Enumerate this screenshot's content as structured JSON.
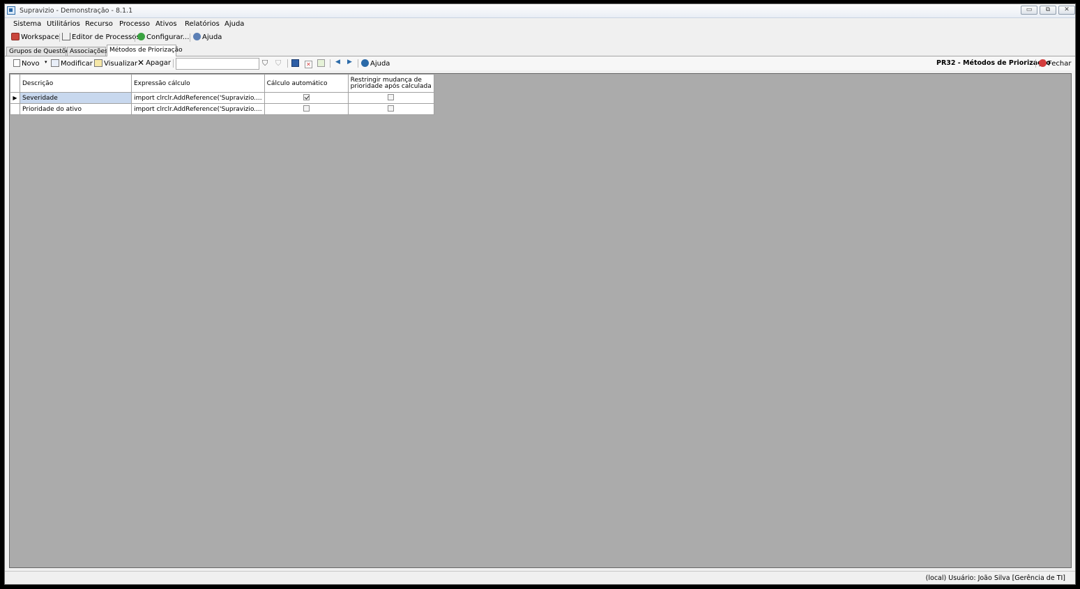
{
  "window": {
    "title": "Supravizio - Demonstração - 8.1.1",
    "btn_min": "▭",
    "btn_max": "⧉",
    "btn_close": "✕"
  },
  "menu": [
    "Sistema",
    "Utilitários",
    "Recurso",
    "Processo",
    "Ativos",
    "Relatórios",
    "Ajuda"
  ],
  "toolbar": {
    "workspace": "Workspace",
    "editor": "Editor de Processos",
    "configurar": "Configurar...",
    "ajuda": "Ajuda"
  },
  "tabs": [
    "Grupos de Questões",
    "Associações",
    "Métodos de Priorização"
  ],
  "actions": {
    "novo": "Novo",
    "modificar": "Modificar",
    "visualizar": "Visualizar",
    "apagar": "Apagar",
    "search_value": "",
    "ajuda": "Ajuda",
    "form_title": "PR32 - Métodos de Priorização",
    "fechar": "Fechar"
  },
  "grid": {
    "headers": [
      "Descrição",
      "Expressão cálculo",
      "Cálculo automático",
      "Restringir mudança de",
      "prioridade após calculada"
    ],
    "rows": [
      {
        "descricao": "Severidade",
        "expressao": "import clrclr.AddReference('Supravizio....",
        "calculo_automatico": true,
        "restringir": false
      },
      {
        "descricao": "Prioridade do ativo",
        "expressao": "import clrclr.AddReference('Supravizio....",
        "calculo_automatico": false,
        "restringir": false
      }
    ]
  },
  "status": "(local)  Usuário: João Silva [Gerência de TI]",
  "icons": [
    "app-icon",
    "workspace-icon",
    "editor-icon",
    "configurar-icon",
    "help-icon",
    "novo-icon",
    "dropdown-arrow-icon",
    "modificar-icon",
    "visualizar-icon",
    "apagar-icon",
    "filter-icon",
    "filter-clear-icon",
    "save-icon",
    "cancel-icon",
    "refresh-icon",
    "prev-icon",
    "next-icon",
    "close-icon"
  ],
  "colors": {
    "accent": "#2b6aa8",
    "selection": "#c8d8ee",
    "grid_background": "#ababab",
    "close_red": "#d33c3c"
  }
}
